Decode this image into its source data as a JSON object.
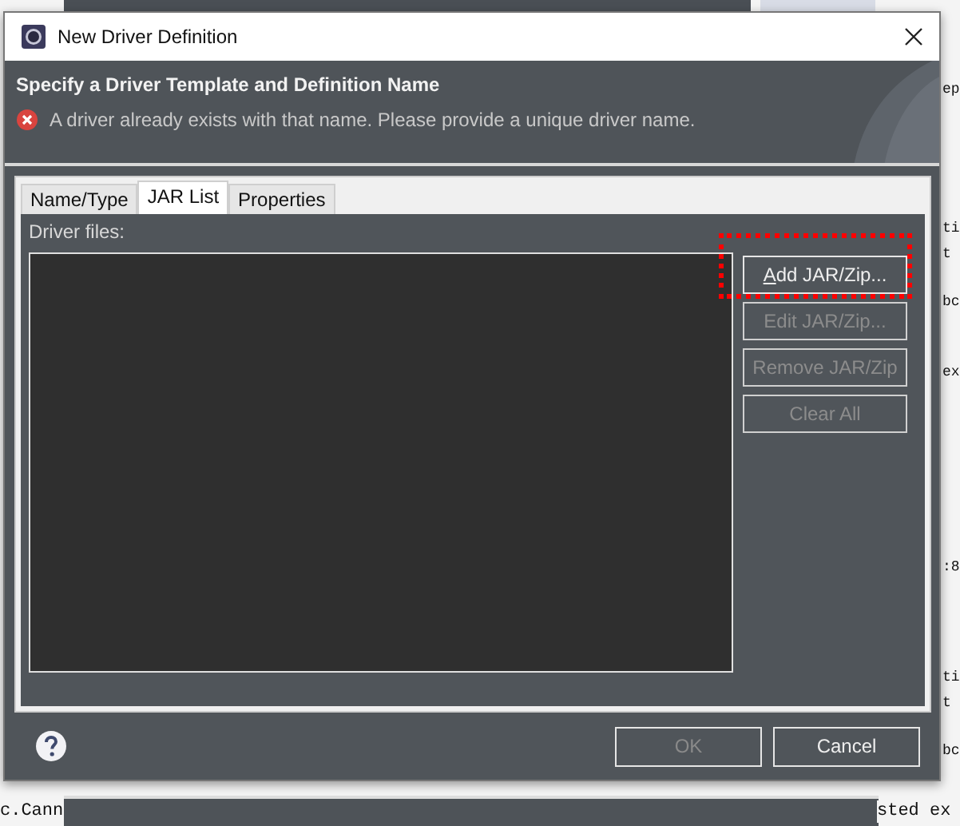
{
  "background_code": [
    {
      "text": "ep"
    },
    {
      "text": "ti"
    },
    {
      "text": "t"
    },
    {
      "text": "bc"
    },
    {
      "text": "ex"
    },
    {
      "text": ":8"
    },
    {
      "text": "ti"
    },
    {
      "text": "t"
    },
    {
      "text": "bc"
    }
  ],
  "background_bottom": [
    {
      "text": "c.Cann"
    },
    {
      "text": "sted ex"
    }
  ],
  "window": {
    "title": "New Driver Definition"
  },
  "header": {
    "title": "Specify a Driver Template and Definition Name",
    "error": "A driver already exists with that name. Please provide a unique driver name."
  },
  "tabs": [
    {
      "label": "Name/Type",
      "selected": false
    },
    {
      "label": "JAR List",
      "selected": true
    },
    {
      "label": "Properties",
      "selected": false
    }
  ],
  "driver_files": {
    "label": "Driver files:"
  },
  "side_buttons": [
    {
      "label": "Add JAR/Zip...",
      "first_letter_underlined": true,
      "disabled": false,
      "highlighted": true
    },
    {
      "label": "Edit JAR/Zip...",
      "first_letter_underlined": false,
      "disabled": true,
      "highlighted": false
    },
    {
      "label": "Remove JAR/Zip",
      "first_letter_underlined": false,
      "disabled": true,
      "highlighted": false
    },
    {
      "label": "Clear All",
      "first_letter_underlined": false,
      "disabled": true,
      "highlighted": false
    }
  ],
  "buttons": [
    {
      "label": "OK",
      "disabled": true
    },
    {
      "label": "Cancel",
      "disabled": false
    }
  ]
}
